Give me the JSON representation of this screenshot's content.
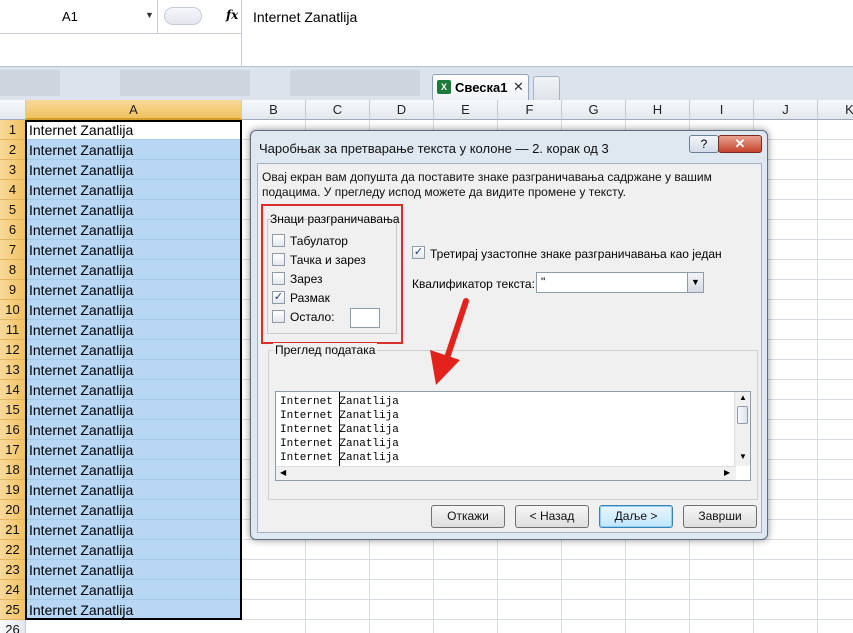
{
  "formula_bar": {
    "name_box": "A1",
    "fx_label": "fx",
    "formula_value": "Internet Zanatlija"
  },
  "workbook_tab": {
    "title": "Свеска1",
    "close": "✕",
    "icon_text": "X"
  },
  "columns": [
    "A",
    "B",
    "C",
    "D",
    "E",
    "F",
    "G",
    "H",
    "I",
    "J",
    "K"
  ],
  "rows": [
    {
      "num": "1",
      "a": "Internet Zanatlija"
    },
    {
      "num": "2",
      "a": "Internet Zanatlija"
    },
    {
      "num": "3",
      "a": "Internet Zanatlija"
    },
    {
      "num": "4",
      "a": "Internet Zanatlija"
    },
    {
      "num": "5",
      "a": "Internet Zanatlija"
    },
    {
      "num": "6",
      "a": "Internet Zanatlija"
    },
    {
      "num": "7",
      "a": "Internet Zanatlija"
    },
    {
      "num": "8",
      "a": "Internet Zanatlija"
    },
    {
      "num": "9",
      "a": "Internet Zanatlija"
    },
    {
      "num": "10",
      "a": "Internet Zanatlija"
    },
    {
      "num": "11",
      "a": "Internet Zanatlija"
    },
    {
      "num": "12",
      "a": "Internet Zanatlija"
    },
    {
      "num": "13",
      "a": "Internet Zanatlija"
    },
    {
      "num": "14",
      "a": "Internet Zanatlija"
    },
    {
      "num": "15",
      "a": "Internet Zanatlija"
    },
    {
      "num": "16",
      "a": "Internet Zanatlija"
    },
    {
      "num": "17",
      "a": "Internet Zanatlija"
    },
    {
      "num": "18",
      "a": "Internet Zanatlija"
    },
    {
      "num": "19",
      "a": "Internet Zanatlija"
    },
    {
      "num": "20",
      "a": "Internet Zanatlija"
    },
    {
      "num": "21",
      "a": "Internet Zanatlija"
    },
    {
      "num": "22",
      "a": "Internet Zanatlija"
    },
    {
      "num": "23",
      "a": "Internet Zanatlija"
    },
    {
      "num": "24",
      "a": "Internet Zanatlija"
    },
    {
      "num": "25",
      "a": "Internet Zanatlija"
    },
    {
      "num": "26",
      "a": ""
    }
  ],
  "dialog": {
    "title": "Чаробњак за претварање текста у колоне — 2. корак од 3",
    "help": "?",
    "close": "✕",
    "description": "Овај екран вам допушта да поставите знаке разграничавања садржане у вашим подацима. У прегледу испод можете да видите промене у тексту.",
    "delimiters": {
      "legend": "Знаци разграничавања",
      "items": [
        {
          "label": "Табулатор",
          "checked": false
        },
        {
          "label": "Тачка и зарез",
          "checked": false
        },
        {
          "label": "Зарез",
          "checked": false
        },
        {
          "label": "Размак",
          "checked": true
        },
        {
          "label": "Остало:",
          "checked": false
        }
      ],
      "other_value": ""
    },
    "treat_consecutive": {
      "label": "Третирај узастопне знаке разграничавања као један",
      "checked": true
    },
    "text_qualifier": {
      "label": "Квалификатор текста:",
      "value": "\""
    },
    "preview": {
      "legend": "Преглед података",
      "lines": [
        "Internet Zanatlija",
        "Internet Zanatlija",
        "Internet Zanatlija",
        "Internet Zanatlija",
        "Internet Zanatlija"
      ]
    },
    "buttons": {
      "cancel": "Откажи",
      "back": "< Назад",
      "next": "Даље >",
      "finish": "Заврши"
    }
  },
  "colors": {
    "selection": "#b7d7f5",
    "header_selected": "#f1c15f",
    "annotation_red": "#e3231b"
  }
}
